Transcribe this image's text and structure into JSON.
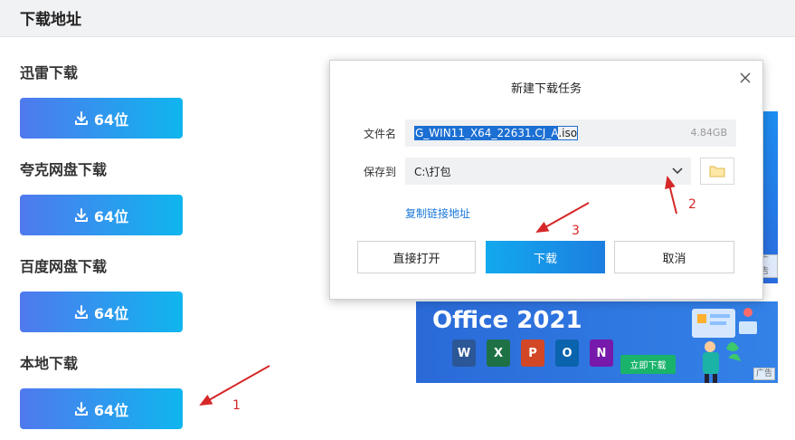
{
  "header": {
    "title": "下载地址"
  },
  "sections": [
    {
      "title": "迅雷下载",
      "button_label": "64位"
    },
    {
      "title": "夸克网盘下载",
      "button_label": "64位"
    },
    {
      "title": "百度网盘下载",
      "button_label": "64位"
    },
    {
      "title": "本地下载",
      "button_label": "64位"
    }
  ],
  "banners": {
    "top_ad_tag": "广告",
    "office": {
      "title": "Office 2021",
      "cta": "立即下载",
      "ad_tag": "广告",
      "apps": [
        {
          "letter": "W",
          "color": "#2b5797"
        },
        {
          "letter": "X",
          "color": "#1e7145"
        },
        {
          "letter": "P",
          "color": "#d24726"
        },
        {
          "letter": "O",
          "color": "#0a64ad"
        },
        {
          "letter": "N",
          "color": "#7719aa"
        }
      ]
    }
  },
  "dialog": {
    "title": "新建下载任务",
    "filename_label": "文件名",
    "filename_selected": "G_WIN11_X64_22631.CJ_A",
    "filename_ext": ".iso",
    "file_size": "4.84GB",
    "save_label": "保存到",
    "save_path": "C:\\打包",
    "copy_link": "复制链接地址",
    "buttons": {
      "open": "直接打开",
      "download": "下载",
      "cancel": "取消"
    }
  },
  "annotations": {
    "one": "1",
    "two": "2",
    "three": "3"
  },
  "colors": {
    "button_gradient_start": "#4f79ee",
    "button_gradient_end": "#0fb6ee",
    "annotation": "#d62728",
    "link": "#1b78d9"
  }
}
